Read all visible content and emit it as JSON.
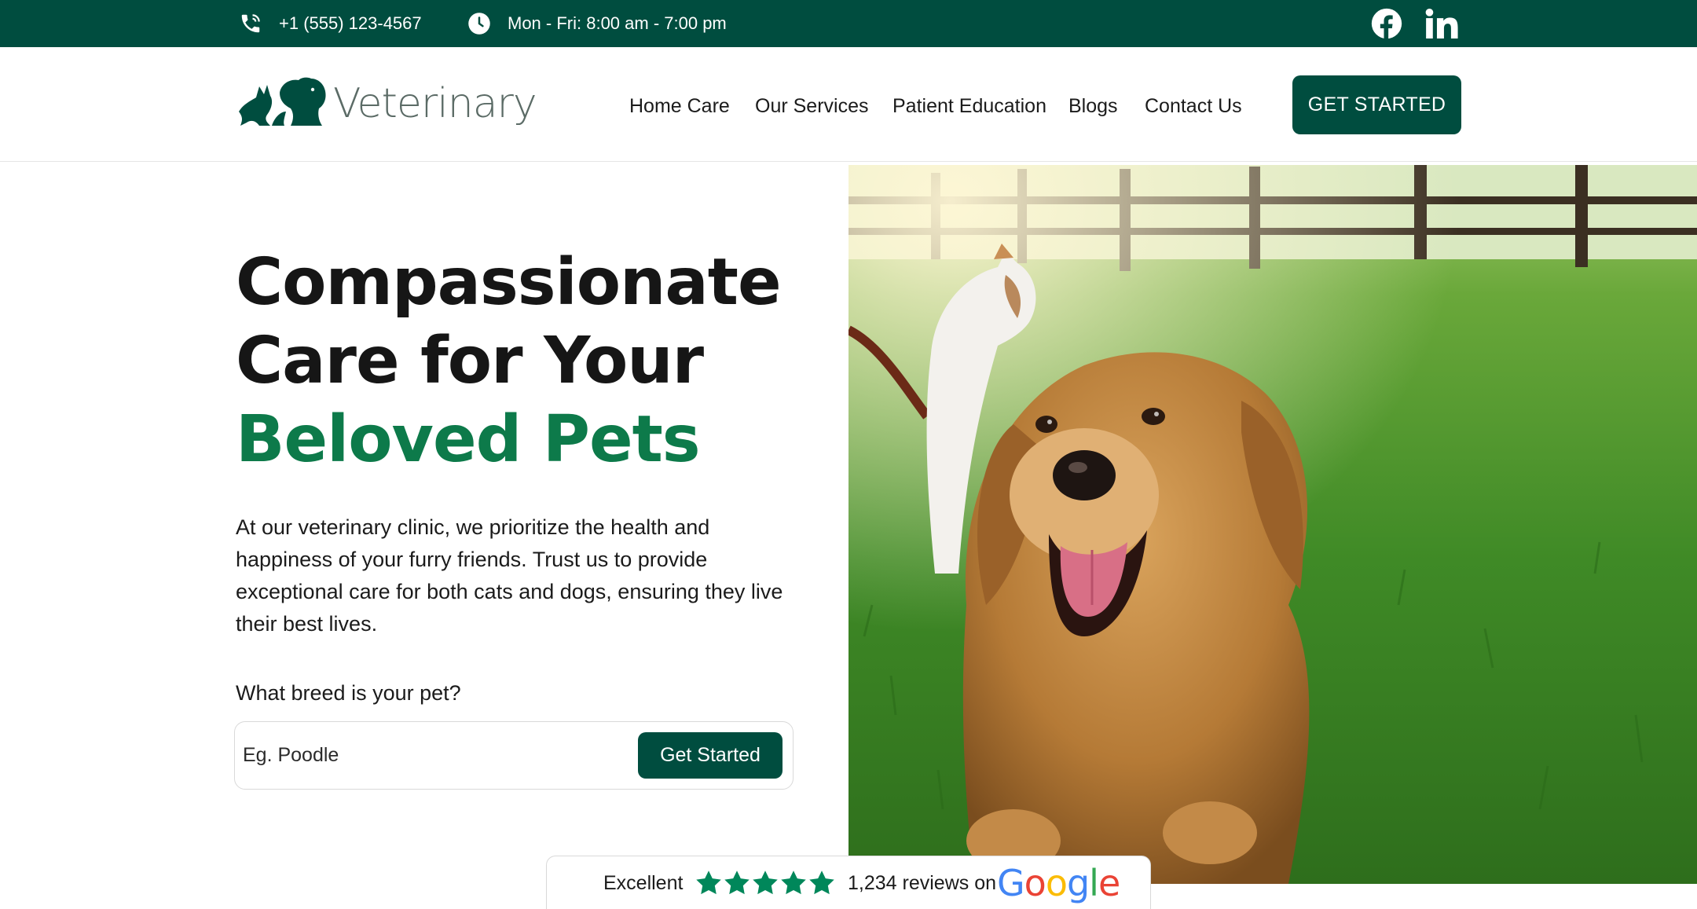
{
  "topbar": {
    "phone": "+1 (555) 123-4567",
    "hours": "Mon - Fri: 8:00 am - 7:00 pm",
    "social": [
      "facebook-icon",
      "linkedin-icon"
    ]
  },
  "header": {
    "logo_text": "Veterinary",
    "nav": [
      "Home Care",
      "Our Services",
      "Patient Education",
      "Blogs",
      "Contact Us"
    ],
    "cta": "GET STARTED"
  },
  "hero": {
    "title_line1": "Compassionate",
    "title_line2": "Care for Your",
    "title_accent": "Beloved Pets",
    "description": "At our veterinary clinic, we prioritize the health and happiness of your furry friends. Trust us to provide exceptional care for both cats and dogs, ensuring they live their best lives.",
    "breed_question": "What breed is your pet?",
    "breed_placeholder": "Eg. Poodle",
    "breed_button": "Get Started"
  },
  "review": {
    "rating_word": "Excellent",
    "stars": 5,
    "count_text": "1,234 reviews on",
    "brand": "Google"
  },
  "colors": {
    "primary": "#004d3f",
    "accent": "#0d7a4a",
    "star": "#00875a"
  }
}
